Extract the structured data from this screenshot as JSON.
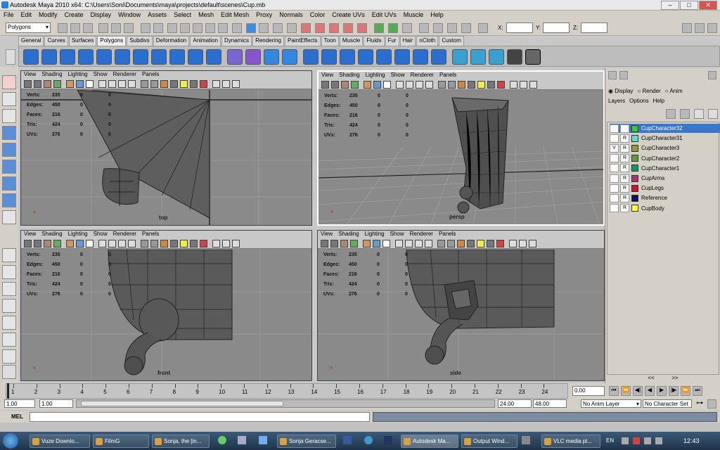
{
  "window": {
    "title": "Autodesk Maya 2010 x64: C:\\Users\\Soni\\Documents\\maya\\projects\\default\\scenes\\Cup.mb"
  },
  "menu": [
    "File",
    "Edit",
    "Modify",
    "Create",
    "Display",
    "Window",
    "Assets",
    "Select",
    "Mesh",
    "Edit Mesh",
    "Proxy",
    "Normals",
    "Color",
    "Create UVs",
    "Edit UVs",
    "Muscle",
    "Help"
  ],
  "status": {
    "mode": "Polygons",
    "x_label": "X:",
    "y_label": "Y:",
    "z_label": "Z:"
  },
  "shelf_tabs": [
    "General",
    "Curves",
    "Surfaces",
    "Polygons",
    "Subdivs",
    "Deformation",
    "Animation",
    "Dynamics",
    "Rendering",
    "PaintEffects",
    "Toon",
    "Muscle",
    "Fluids",
    "Fur",
    "Hair",
    "nCloth",
    "Custom"
  ],
  "shelf_active": "Polygons",
  "panel_menu": [
    "View",
    "Shading",
    "Lighting",
    "Show",
    "Renderer",
    "Panels"
  ],
  "hud": {
    "labels": [
      "Verts:",
      "Edges:",
      "Faces:",
      "Tris:",
      "UVs:"
    ],
    "col1": [
      "235",
      "450",
      "216",
      "424",
      "276"
    ],
    "col2": [
      "0",
      "0",
      "0",
      "0",
      "0"
    ],
    "col3": [
      "0",
      "0",
      "0",
      "0",
      "0"
    ]
  },
  "viewports": {
    "top": "top",
    "persp": "persp",
    "front": "front",
    "side": "side"
  },
  "layer_panel": {
    "modes": [
      "Display",
      "Render",
      "Anim"
    ],
    "menu": [
      "Layers",
      "Options",
      "Help"
    ],
    "layers": [
      {
        "v": "",
        "r": "",
        "name": "CupCharacter32",
        "color": "#33cc33",
        "selected": true
      },
      {
        "v": "",
        "r": "R",
        "name": "CupCharacter31",
        "color": "#66ddcc",
        "selected": false
      },
      {
        "v": "V",
        "r": "R",
        "name": "CupCharacter3",
        "color": "#9a9a33",
        "selected": false
      },
      {
        "v": "",
        "r": "R",
        "name": "CupCharacter2",
        "color": "#669933",
        "selected": false
      },
      {
        "v": "",
        "r": "R",
        "name": "CupCharacter1",
        "color": "#119966",
        "selected": false
      },
      {
        "v": "",
        "r": "R",
        "name": "CupArms",
        "color": "#aa3377",
        "selected": false
      },
      {
        "v": "",
        "r": "R",
        "name": "CupLegs",
        "color": "#cc1133",
        "selected": false
      },
      {
        "v": "",
        "r": "R",
        "name": "Reference",
        "color": "#111155",
        "selected": false
      },
      {
        "v": "",
        "r": "R",
        "name": "CupBody",
        "color": "#ffff33",
        "selected": false
      }
    ]
  },
  "timeline": {
    "ticks": [
      "1",
      "2",
      "3",
      "4",
      "5",
      "6",
      "7",
      "8",
      "9",
      "10",
      "11",
      "12",
      "13",
      "14",
      "15",
      "16",
      "17",
      "18",
      "19",
      "20",
      "21",
      "22",
      "23",
      "24"
    ],
    "current": "0.00"
  },
  "range": {
    "start": "1.00",
    "start2": "1.00",
    "end": "24.00",
    "end2": "48.00",
    "anim_layer": "No Anim Layer",
    "char_set": "No Character Set"
  },
  "cmdline": {
    "label": "MEL"
  },
  "taskbar": {
    "tasks": [
      "Vuze Downlo...",
      "FilmG",
      "Sonja, the [in...",
      "Sonja Geracse...",
      "Autodesk Ma...",
      "Output Wind...",
      "VLC media pl..."
    ],
    "lang": "EN",
    "clock": "12:43"
  }
}
